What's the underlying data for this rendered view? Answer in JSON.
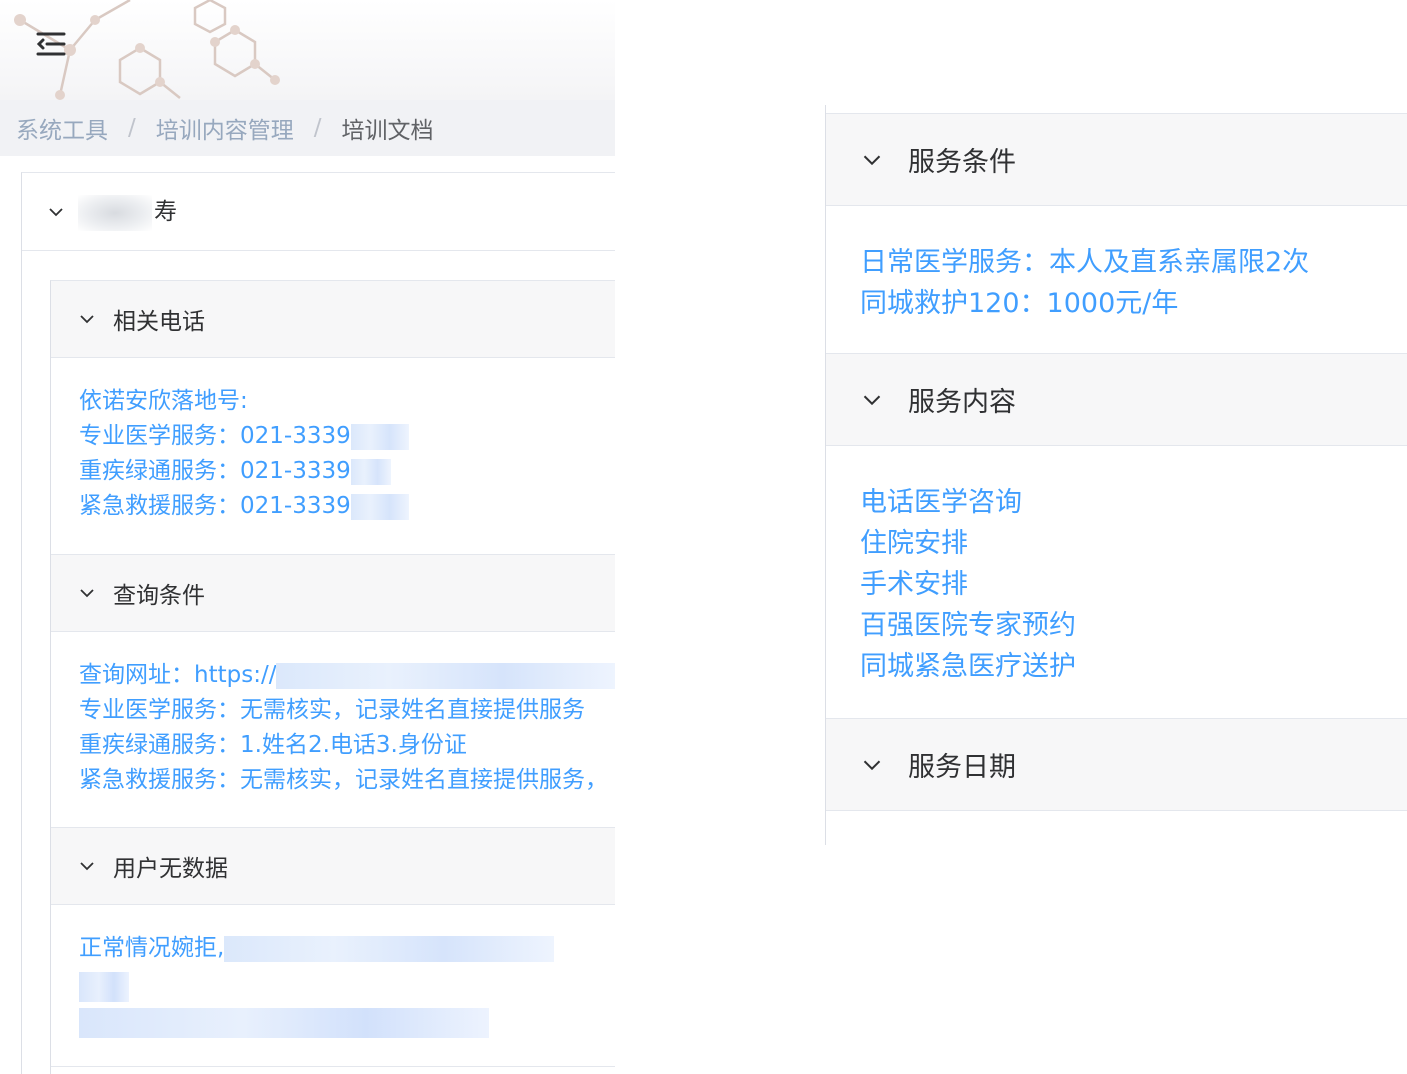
{
  "breadcrumb": {
    "items": [
      "系统工具",
      "培训内容管理",
      "培训文档"
    ],
    "separator": "/"
  },
  "outer_panel": {
    "title_suffix": "寿"
  },
  "sections_left": {
    "phones": {
      "title": "相关电话",
      "lines": [
        "依诺安欣落地号:",
        "专业医学服务：021-3339",
        "重疾绿通服务：021-3339",
        "紧急救援服务：021-3339"
      ]
    },
    "query": {
      "title": "查询条件",
      "lines": [
        "查询网址：https://",
        "专业医学服务：无需核实，记录姓名直接提供服务",
        "重疾绿通服务：1.姓名2.电话3.身份证",
        "紧急救援服务：无需核实，记录姓名直接提供服务，"
      ]
    },
    "no_data": {
      "title": "用户无数据",
      "lines": [
        "正常情况婉拒,"
      ]
    }
  },
  "sections_right": {
    "conditions": {
      "title": "服务条件",
      "lines": [
        "日常医学服务：本人及直系亲属限2次",
        "同城救护120：1000元/年"
      ]
    },
    "content": {
      "title": "服务内容",
      "lines": [
        "电话医学咨询",
        "住院安排",
        "手术安排",
        "百强医院专家预约",
        "同城紧急医疗送护"
      ]
    },
    "dates": {
      "title": "服务日期"
    }
  },
  "colors": {
    "link_blue": "#409eff",
    "header_gray": "#f7f7f8",
    "border": "#e4e7ed",
    "breadcrumb_muted": "#97a8be"
  },
  "icons": [
    "menu-fold-icon",
    "chevron-down-icon",
    "molecule-decoration"
  ]
}
